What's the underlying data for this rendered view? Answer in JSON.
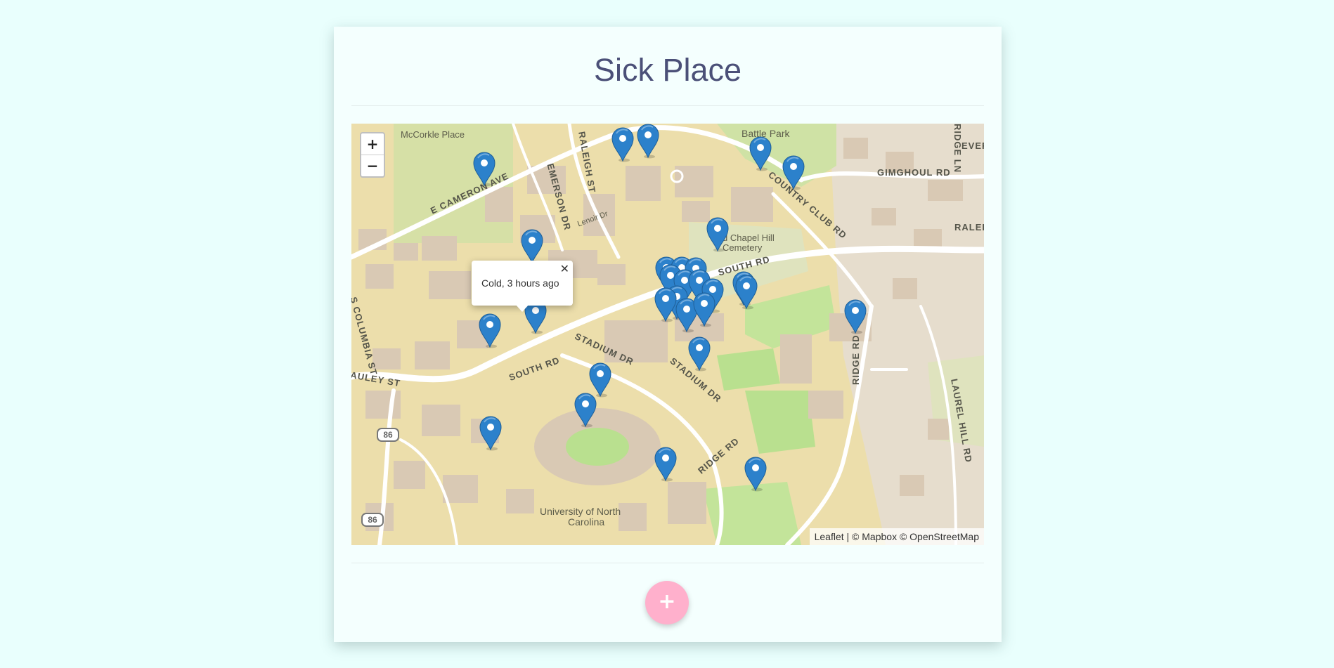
{
  "page": {
    "title": "Sick Place"
  },
  "map": {
    "zoom_in": "+",
    "zoom_out": "−",
    "popup": {
      "text": "Cold, 3 hours ago",
      "close": "✕"
    },
    "attribution": "Leaflet | © Mapbox © OpenStreetMap",
    "places": [
      "McCorkle Place",
      "Battle Park",
      "Old Chapel Hill",
      "Cemetery",
      "University of North",
      "Carolina",
      "Lenoir Dr"
    ],
    "streets": [
      "E CAMERON AVE",
      "EMERSON DR",
      "RALEIGH ST",
      "COUNTRY CLUB RD",
      "GIMGHOUL RD",
      "RIDGE LN",
      "EVER",
      "RALEIG",
      "SOUTH RD",
      "SOUTH RD",
      "STADIUM DR",
      "STADIUM DR",
      "RIDGE RD",
      "RIDGE RD",
      "LAUREL HILL RD",
      "S COLUMBIA ST",
      "AULEY ST"
    ],
    "route_shields": [
      "86",
      "86"
    ],
    "marker_color": "#2c81cb",
    "marker_icon": "map-pin-icon"
  },
  "actions": {
    "add_label": "+",
    "add_color": "#ffb0cc"
  }
}
